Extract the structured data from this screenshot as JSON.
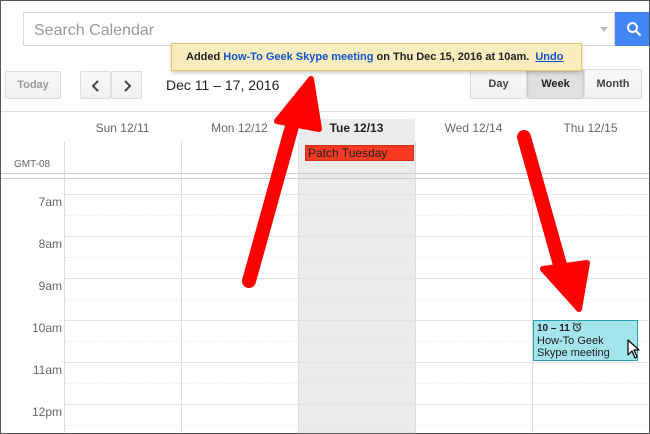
{
  "search": {
    "placeholder": "Search Calendar"
  },
  "notification": {
    "prefix": "Added ",
    "event_link": "How-To Geek Skype meeting",
    "suffix": " on Thu Dec 15, 2016 at 10am.",
    "undo": "Undo"
  },
  "toolbar": {
    "today": "Today",
    "date_range": "Dec 11 – 17, 2016",
    "views": {
      "day": "Day",
      "week": "Week",
      "month": "Month"
    },
    "selected_view": "Week"
  },
  "calendar": {
    "timezone": "GMT-08",
    "days": [
      "Sun 12/11",
      "Mon 12/12",
      "Tue 12/13",
      "Wed 12/14",
      "Thu 12/15"
    ],
    "today": "Tue 12/13",
    "hours": [
      "7am",
      "8am",
      "9am",
      "10am",
      "11am",
      "12pm"
    ],
    "all_day_events": [
      {
        "title": "Patch Tuesday",
        "day": "Tue 12/13",
        "color": "#f83a22"
      }
    ],
    "events": [
      {
        "time": "10 – 11",
        "title_line1": "How-To Geek",
        "title_line2": "Skype meeting",
        "day": "Thu 12/15",
        "color": "#a4e4ec",
        "icon": "alarm-clock-icon"
      }
    ]
  },
  "colors": {
    "accent": "#4285f4",
    "annotation_arrow": "#ff0000",
    "notice_bg": "#f9edbe"
  }
}
